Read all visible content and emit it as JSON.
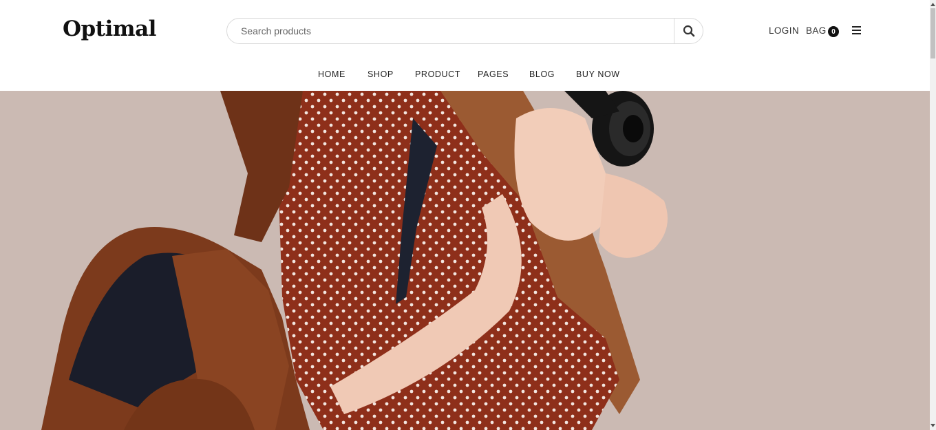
{
  "header": {
    "logo": "Optimal",
    "search": {
      "placeholder": "Search products",
      "value": ""
    },
    "login_label": "LOGIN",
    "bag_label": "BAG",
    "bag_count": "0"
  },
  "nav": {
    "items": [
      {
        "label": "HOME"
      },
      {
        "label": "SHOP"
      },
      {
        "label": "PRODUCT"
      },
      {
        "label": "PAGES"
      },
      {
        "label": "BLOG"
      },
      {
        "label": "BUY NOW"
      }
    ]
  },
  "icons": {
    "search": "search-icon",
    "menu": "hamburger-icon"
  },
  "colors": {
    "hero_background": "#cbbab3",
    "accent_dark": "#111111",
    "text": "#333333"
  }
}
